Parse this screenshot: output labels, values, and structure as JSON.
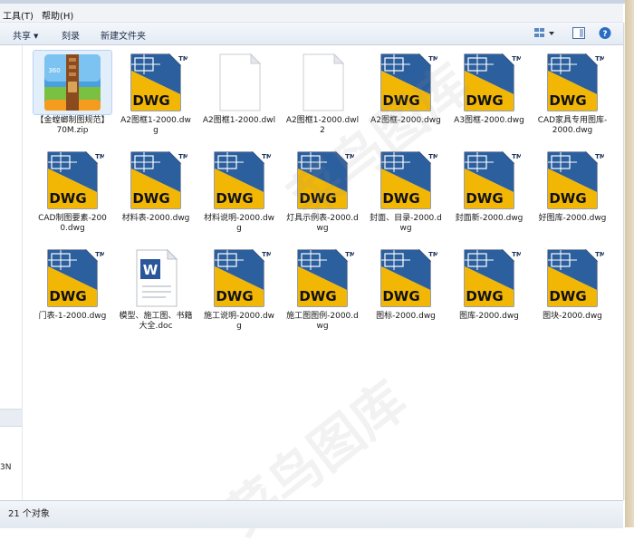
{
  "menu": {
    "tools": "工具(T)",
    "help": "帮助(H)"
  },
  "toolbar": {
    "share": "共享",
    "burn": "刻录",
    "new_folder": "新建文件夹"
  },
  "nav": {
    "partial_label": "3N"
  },
  "files": [
    {
      "name": "【金螳螂制图规范】70M.zip",
      "type": "zip"
    },
    {
      "name": "A2图框1-2000.dwg",
      "type": "dwg"
    },
    {
      "name": "A2图框1-2000.dwl",
      "type": "blank"
    },
    {
      "name": "A2图框1-2000.dwl2",
      "type": "blank"
    },
    {
      "name": "A2图框-2000.dwg",
      "type": "dwg"
    },
    {
      "name": "A3图框-2000.dwg",
      "type": "dwg"
    },
    {
      "name": "CAD家具专用图库-2000.dwg",
      "type": "dwg"
    },
    {
      "name": "CAD制图要素-2000.dwg",
      "type": "dwg"
    },
    {
      "name": "材料表-2000.dwg",
      "type": "dwg"
    },
    {
      "name": "材料说明-2000.dwg",
      "type": "dwg"
    },
    {
      "name": "灯具示例表-2000.dwg",
      "type": "dwg"
    },
    {
      "name": "封面、目录-2000.dwg",
      "type": "dwg"
    },
    {
      "name": "封面新-2000.dwg",
      "type": "dwg"
    },
    {
      "name": "好图库-2000.dwg",
      "type": "dwg"
    },
    {
      "name": "门表-1-2000.dwg",
      "type": "dwg"
    },
    {
      "name": "模型、施工图、书籍大全.doc",
      "type": "doc"
    },
    {
      "name": "施工说明-2000.dwg",
      "type": "dwg"
    },
    {
      "name": "施工图图例-2000.dwg",
      "type": "dwg"
    },
    {
      "name": "图标-2000.dwg",
      "type": "dwg"
    },
    {
      "name": "图库-2000.dwg",
      "type": "dwg"
    },
    {
      "name": "图块-2000.dwg",
      "type": "dwg"
    }
  ],
  "icons": {
    "dwg_text": "DWG",
    "tm": "TM",
    "zip_text": "360 ZIP",
    "doc_letter": "W"
  },
  "colors": {
    "dwg_yellow": "#f2b705",
    "dwg_blue": "#2c5f9e",
    "doc_blue": "#2b579a",
    "zip_blue": "#4a9fe0"
  },
  "status": {
    "count": "21 个对象"
  },
  "watermark": {
    "text": "菜鸟图库"
  }
}
